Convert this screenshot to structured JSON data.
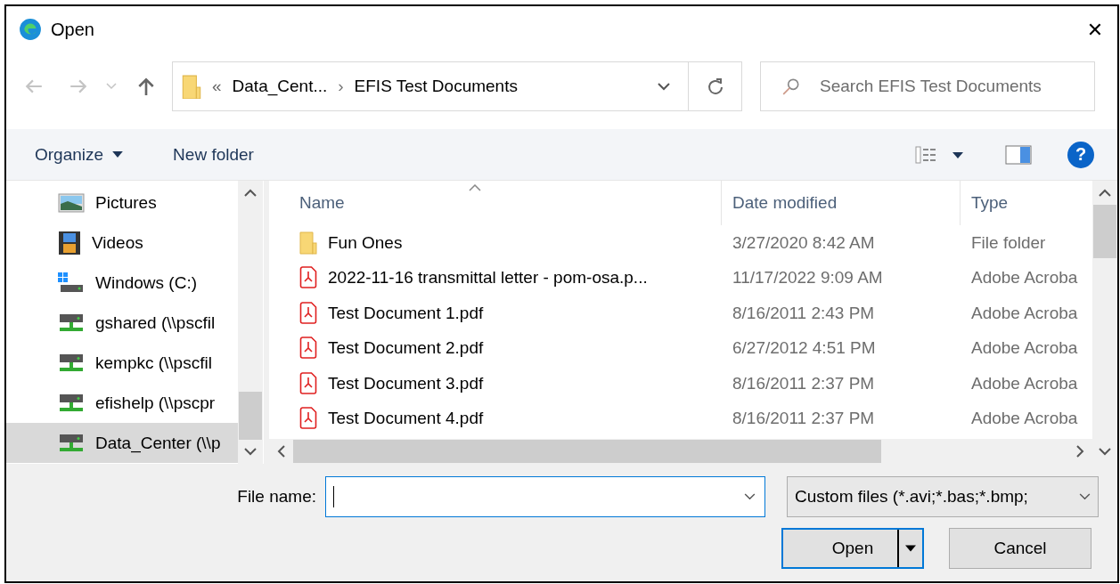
{
  "window": {
    "title": "Open",
    "close": "✕"
  },
  "address": {
    "overflow": "«",
    "crumbs": [
      "Data_Cent...",
      "EFIS Test Documents"
    ],
    "separator": "›"
  },
  "search": {
    "placeholder": "Search EFIS Test Documents"
  },
  "toolbar": {
    "organize": "Organize",
    "new_folder": "New folder",
    "help": "?"
  },
  "sidebar": {
    "items": [
      {
        "label": "Pictures",
        "kind": "pictures",
        "selected": false
      },
      {
        "label": "Videos",
        "kind": "videos",
        "selected": false
      },
      {
        "label": "Windows (C:)",
        "kind": "drive",
        "selected": false
      },
      {
        "label": "gshared (\\\\pscfil",
        "kind": "network",
        "selected": false
      },
      {
        "label": "kempkc (\\\\pscfil",
        "kind": "network",
        "selected": false
      },
      {
        "label": "efishelp (\\\\pscpr",
        "kind": "network",
        "selected": false
      },
      {
        "label": "Data_Center (\\\\p",
        "kind": "network",
        "selected": true
      }
    ]
  },
  "table": {
    "columns": [
      "Name",
      "Date modified",
      "Type"
    ],
    "rows": [
      {
        "kind": "folder",
        "name": "Fun Ones",
        "date": "3/27/2020 8:42 AM",
        "type": "File folder"
      },
      {
        "kind": "pdf",
        "name": "2022-11-16 transmittal letter - pom-osa.p...",
        "date": "11/17/2022 9:09 AM",
        "type": "Adobe Acroba"
      },
      {
        "kind": "pdf",
        "name": "Test Document 1.pdf",
        "date": "8/16/2011 2:43 PM",
        "type": "Adobe Acroba"
      },
      {
        "kind": "pdf",
        "name": "Test Document 2.pdf",
        "date": "6/27/2012 4:51 PM",
        "type": "Adobe Acroba"
      },
      {
        "kind": "pdf",
        "name": "Test Document 3.pdf",
        "date": "8/16/2011 2:37 PM",
        "type": "Adobe Acroba"
      },
      {
        "kind": "pdf",
        "name": "Test Document 4.pdf",
        "date": "8/16/2011 2:37 PM",
        "type": "Adobe Acroba"
      }
    ]
  },
  "file_name": {
    "label": "File name:"
  },
  "filter": {
    "value": "Custom files (*.avi;*.bas;*.bmp;"
  },
  "buttons": [
    {
      "label": "Open",
      "primary": true
    },
    {
      "label": "Cancel",
      "primary": false
    }
  ]
}
